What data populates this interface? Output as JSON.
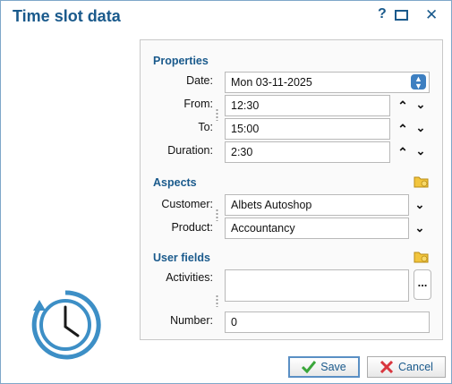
{
  "window": {
    "title": "Time slot data",
    "help_label": "?"
  },
  "properties": {
    "title": "Properties",
    "date_label": "Date:",
    "date_value": "Mon 03-11-2025",
    "from_label": "From:",
    "from_value": "12:30",
    "to_label": "To:",
    "to_value": "15:00",
    "duration_label": "Duration:",
    "duration_value": "2:30"
  },
  "aspects": {
    "title": "Aspects",
    "customer_label": "Customer:",
    "customer_value": "Albets Autoshop",
    "product_label": "Product:",
    "product_value": "Accountancy"
  },
  "user_fields": {
    "title": "User fields",
    "activities_label": "Activities:",
    "activities_value": "",
    "activities_button": "...",
    "number_label": "Number:",
    "number_value": "0"
  },
  "buttons": {
    "save_label": "Save",
    "cancel_label": "Cancel"
  },
  "colors": {
    "accent": "#1a5a8c",
    "clock": "#3d8fc6"
  },
  "icons": [
    "help-icon",
    "maximize-icon",
    "close-icon",
    "calendar-dropdown-icon",
    "chevron-up-icon",
    "chevron-down-icon",
    "folder-icon",
    "clock-icon",
    "checkmark-icon",
    "cancel-x-icon"
  ]
}
